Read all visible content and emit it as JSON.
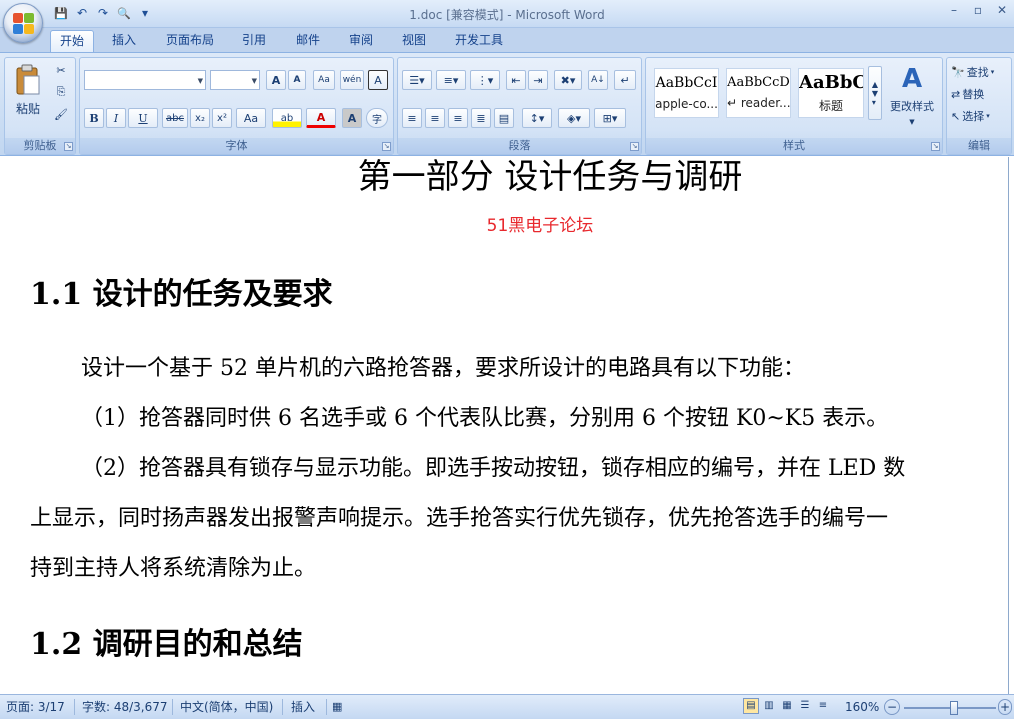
{
  "window": {
    "title": "1.doc [兼容模式] - Microsoft Word",
    "controls": [
      "–",
      "▫",
      "✕"
    ]
  },
  "qat": {
    "save": "💾",
    "undo": "↶",
    "redo": "↷",
    "preview": "🔍",
    "customize": "▾"
  },
  "tabs": [
    "开始",
    "插入",
    "页面布局",
    "引用",
    "邮件",
    "审阅",
    "视图",
    "开发工具"
  ],
  "ribbon": {
    "clipboard": {
      "label": "剪贴板",
      "paste": "粘贴"
    },
    "font": {
      "label": "字体",
      "font_name": "",
      "font_size": "",
      "grow": "A",
      "shrink": "A",
      "clear": "Aa",
      "pinyin": "wén",
      "char_border": "A",
      "bold": "B",
      "italic": "I",
      "underline": "U",
      "strike": "abc",
      "subscript": "x₂",
      "superscript": "x²",
      "change_case": "Aa",
      "highlight": "ab",
      "font_color": "A",
      "shading": "A",
      "enclose": "字"
    },
    "paragraph": {
      "label": "段落"
    },
    "styles": {
      "label": "样式",
      "items": [
        {
          "preview": "AaBbCcI",
          "name": "apple-co..."
        },
        {
          "preview": "AaBbCcD",
          "name": "↵ reader..."
        },
        {
          "preview": "AaBbC",
          "name": "标题"
        }
      ],
      "change": "更改样式"
    },
    "editing": {
      "label": "编辑",
      "find": "查找",
      "replace": "替换",
      "select": "选择"
    }
  },
  "document": {
    "part_title": "第一部分  设计任务与调研",
    "watermark_text": "51黑电子论坛",
    "h1": "1.1 设计的任务及要求",
    "p1": "设计一个基于 52 单片机的六路抢答器，要求所设计的电路具有以下功能：",
    "p2": "（1）抢答器同时供 6 名选手或 6 个代表队比赛，分别用 6 个按钮 K0~K5 表示。",
    "p3a": "（2）抢答器具有锁存与显示功能。即选手按动按钮，锁存相应的编号，并在 LED 数",
    "p3b": "上显示，同时扬声器发出报警声响提示。选手抢答实行优先锁存，优先抢答选手的编号一",
    "p3c": "持到主持人将系统清除为止。",
    "h2": "1.2 调研目的和总结"
  },
  "status": {
    "page": "页面: 3/17",
    "words": "字数: 48/3,677",
    "lang": "中文(简体，中国)",
    "mode": "插入",
    "zoom": "160%",
    "zoom_out": "−",
    "zoom_in": "+",
    "zoom_fraction": 0.55
  },
  "colors": {
    "accent": "#15428b",
    "watermark": "#e8282d"
  }
}
